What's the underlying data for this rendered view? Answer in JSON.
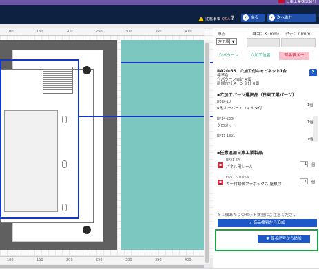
{
  "header": {
    "brand": "日東工業株式会社",
    "caution_label": "注意事項",
    "qa_label": "Q&A",
    "help_icon": "?",
    "back_label": "戻る",
    "next_label": "次へ進む"
  },
  "coords": {
    "origin_label": "原点",
    "x_label": "ヨコ：X (mm)",
    "y_label": "タテ：Y (mm)",
    "origin_value": "左下原点",
    "x_value": "",
    "y_value": ""
  },
  "tabs": [
    "穴パターン",
    "穴加工位置",
    "部品表メモ"
  ],
  "product": {
    "code_name": "RA20-66　穴加工付キャビネット1台",
    "color": "標準色",
    "pattern_total": "穴パターン合計 4個",
    "new_pattern_total": "新規穴パターン合計 0個"
  },
  "parts_section": {
    "title": "▪穴加工パーツ選択品（日東工業パーツ）",
    "items": [
      {
        "code": "RBLP-10",
        "name": "R形ルーバー・フィルタ付",
        "qty": "1個"
      },
      {
        "code": "BP14-26G",
        "name": "グロメット",
        "qty": "1個"
      },
      {
        "code": "BP11-1821",
        "name": "",
        "qty": "1個"
      }
    ]
  },
  "optional_section": {
    "title": "▪任意追加日東工業製品",
    "items": [
      {
        "code": "BP21-5A",
        "name": "パネル用レール",
        "qty": "1",
        "unit": "個"
      },
      {
        "code": "OPK12-1025A",
        "name": "キー付耐候プラボックス(屋根付)",
        "qty": "1",
        "unit": "個"
      }
    ]
  },
  "note": "※１個あたりのセット数量にご注意ください",
  "search_button": "商品検索から追加",
  "add_code_button": "品名記号から追加",
  "ruler_ticks": [
    "100",
    "150",
    "200",
    "250",
    "300",
    "350",
    "400"
  ],
  "colors": {
    "top_purple": "#6e55a8",
    "nav_navy": "#0f2140",
    "accent_blue": "#1c58c8",
    "teal": "#7cc7c0",
    "green": "#1aa36a",
    "red": "#c8102e"
  }
}
